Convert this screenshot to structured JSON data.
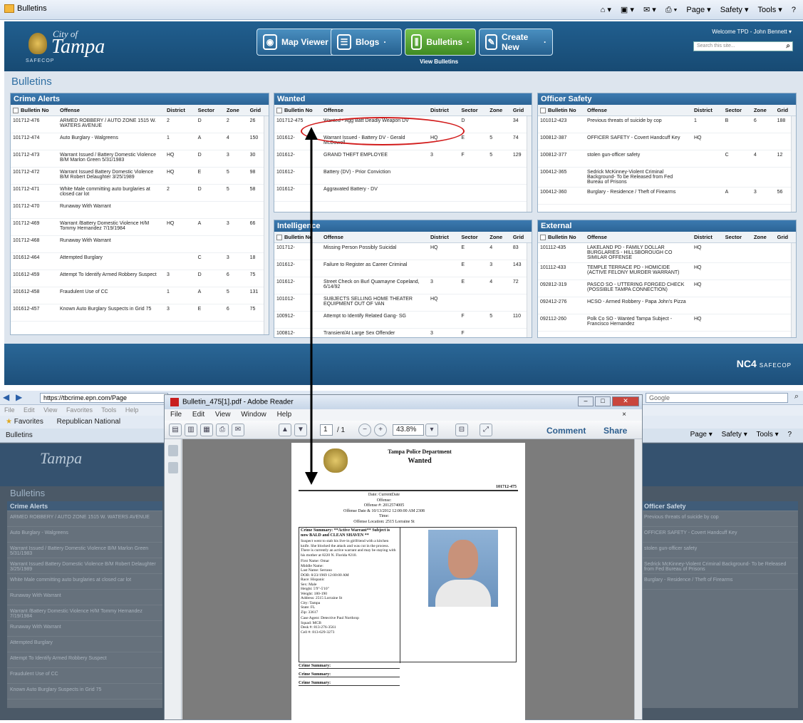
{
  "ie_top": {
    "tab": "Bulletins",
    "commands": [
      "Page ▾",
      "Safety ▾",
      "Tools ▾",
      "?"
    ]
  },
  "site": {
    "city": "City of",
    "name": "Tampa",
    "logo_sub": "SAFECOP",
    "nav": [
      {
        "label": "Map Viewer",
        "icon": "map-pin-icon",
        "active": false
      },
      {
        "label": "Blogs",
        "icon": "chat-icon",
        "active": false
      },
      {
        "label": "Bulletins",
        "icon": "bulletins-icon",
        "active": true
      },
      {
        "label": "Create New",
        "icon": "edit-icon",
        "active": false
      }
    ],
    "view_bulletins": "View Bulletins",
    "welcome": "Welcome TPD - John Bennett",
    "search_placeholder": "Search this site...",
    "page_title": "Bulletins",
    "footer_brand": "NC4",
    "footer_sub": "SAFECOP"
  },
  "columns": [
    "Bulletin No",
    "Offense",
    "District",
    "Sector",
    "Zone",
    "Grid"
  ],
  "crime_alerts": {
    "title": "Crime Alerts",
    "rows": [
      [
        "101712-476",
        "ARMED ROBBERY / AUTO ZONE 1515 W. WATERS AVENUE",
        "2",
        "D",
        "2",
        "26"
      ],
      [
        "101712-474",
        "Auto Burglary - Walgreens",
        "1",
        "A",
        "4",
        "150"
      ],
      [
        "101712-473",
        "Warrant Issued / Battery Domestic Violence B/M Marlon Green 5/31/1983",
        "HQ",
        "D",
        "3",
        "30"
      ],
      [
        "101712-472",
        "Warrant Issued Battery Domestic Violence B/M Robert Delaughter 3/25/1989",
        "HQ",
        "E",
        "5",
        "98"
      ],
      [
        "101712-471",
        "White Male committing auto burglaries at closed car lot",
        "2",
        "D",
        "5",
        "58"
      ],
      [
        "101712-470",
        "Runaway With Warrant",
        "",
        "",
        "",
        ""
      ],
      [
        "101712-469",
        "Warrant /Battery Domestic Violence H/M Tommy Hernandez 7/19/1984",
        "HQ",
        "A",
        "3",
        "66"
      ],
      [
        "101712-468",
        "Runaway With Warrant",
        "",
        "",
        "",
        ""
      ],
      [
        "101612-464",
        "Attempted Burglary",
        "",
        "C",
        "3",
        "18"
      ],
      [
        "101612-459",
        "Attempt To Identify Armed Robbery Suspect",
        "3",
        "D",
        "6",
        "75"
      ],
      [
        "101612-458",
        "Fraudulent Use of CC",
        "1",
        "A",
        "5",
        "131"
      ],
      [
        "101612-457",
        "Known Auto Burglary Suspects in Grid 75",
        "3",
        "E",
        "6",
        "75"
      ]
    ]
  },
  "wanted": {
    "title": "Wanted",
    "rows": [
      [
        "101712-475",
        "Wanted - Agg Batt Deadly Weapon DV",
        "",
        "D",
        "",
        "34"
      ],
      [
        "101612-",
        "Warrant Issued - Battery DV - Gerald McDowell",
        "HQ",
        "E",
        "5",
        "74"
      ],
      [
        "101612-",
        "GRAND THEFT EMPLOYEE",
        "3",
        "F",
        "5",
        "129"
      ],
      [
        "101612-",
        "Battery (DV) - Prior Conviction",
        "",
        "",
        "",
        ""
      ],
      [
        "101612-",
        "Aggravated Battery - DV",
        "",
        "",
        "",
        ""
      ]
    ]
  },
  "intelligence": {
    "title": "Intelligence",
    "rows": [
      [
        "101712-",
        "Missing Person Possibly Suicidal",
        "HQ",
        "E",
        "4",
        "83"
      ],
      [
        "101612-",
        "Failure to Register as Career Criminal",
        "",
        "E",
        "3",
        "143"
      ],
      [
        "101612-",
        "Street Check on Burl Quamayne Copeland, 6/14/92",
        "3",
        "E",
        "4",
        "72"
      ],
      [
        "101012-",
        "SUBJECTS SELLING HOME THEATER EQUIPMENT OUT OF VAN",
        "HQ",
        "",
        "",
        ""
      ],
      [
        "100912-",
        "Attempt to Identify Related Gang- SG",
        "",
        "F",
        "5",
        "110"
      ],
      [
        "100812-",
        "Transient/At Large Sex Offender",
        "3",
        "F",
        "",
        ""
      ]
    ]
  },
  "officer_safety": {
    "title": "Officer Safety",
    "rows": [
      [
        "101012-423",
        "Previous threats of suicide by cop",
        "1",
        "B",
        "6",
        "188"
      ],
      [
        "100812-387",
        "OFFICER SAFETY - Covert Handcuff Key",
        "HQ",
        "",
        "",
        ""
      ],
      [
        "100812-377",
        "stolen gun-officer safety",
        "",
        "C",
        "4",
        "12"
      ],
      [
        "100412-365",
        "Sedrick McKinney-Violent Criminal Background- To be Released from Fed Bureau of Prisons",
        "",
        "",
        "",
        ""
      ],
      [
        "100412-360",
        "Burglary - Residence / Theft of Firearms",
        "",
        "A",
        "3",
        "56"
      ]
    ]
  },
  "external": {
    "title": "External",
    "rows": [
      [
        "101112-435",
        "LAKELAND PD - FAMILY DOLLAR BURGLARIES - HILLSBOROUGH CO SIMILAR OFFENSE",
        "HQ",
        "",
        "",
        ""
      ],
      [
        "101112-433",
        "TEMPLE TERRACE PD - HOMICIDE (ACTIVE FELONY MURDER WARRANT)",
        "HQ",
        "",
        "",
        ""
      ],
      [
        "092812-319",
        "PASCO SO - UTTERING FORGED CHECK (POSSIBLE TAMPA CONNECTION)",
        "HQ",
        "",
        "",
        ""
      ],
      [
        "092412-276",
        "HCSO - Armed Robbery - Papa John's Pizza",
        "",
        "",
        "",
        ""
      ],
      [
        "092112-260",
        "Polk Co SO - Wanted Tampa Subject - Francisco Hernandez",
        "HQ",
        "",
        "",
        ""
      ]
    ]
  },
  "ie2": {
    "url": "https://tbcrime.epn.com/Page",
    "search": "Google",
    "menu": [
      "File",
      "Edit",
      "View",
      "Favorites",
      "Tools",
      "Help"
    ],
    "favorites": "Favorites",
    "fav_link": "Republican National",
    "tab": "Bulletins",
    "commands": [
      "Page ▾",
      "Safety ▾",
      "Tools ▾",
      "?"
    ]
  },
  "acrobat": {
    "title": "Bulletin_475[1].pdf - Adobe Reader",
    "menu": [
      "File",
      "Edit",
      "View",
      "Window",
      "Help"
    ],
    "page": "1",
    "page_total": "/ 1",
    "zoom": "43.8%",
    "comment": "Comment",
    "share": "Share"
  },
  "pdf": {
    "dept": "Tampa Police Department",
    "kind": "Wanted",
    "bulletin_no": "101712-475",
    "meta": [
      "Date: CurrentDate",
      "Offense:",
      "Offense #: 2012574005",
      "Offense Date & 10/13/2012 12:00:00 AM 2308",
      "Time:",
      "Offense Location: 2515 Lorraine St"
    ],
    "summary_head": "Crime Summary: **Active Warrant** Subject is now BALD and CLEAN SHAVEN **",
    "summary": "Suspect went to stab his live-in girlfriend with a kitchen knife. She blocked the attack and was cut in the process. There is currently an active warrant and may be staying with his mother at 8220 N. Florida #210.",
    "fields": [
      "First Name: Omar",
      "Middle Name:",
      "Last Name: Serrano",
      "DOB: 8/23/1969 12:00:00 AM",
      "Race: Hispanic",
      "Sex: Male",
      "Height: 5'9\"-5'10\"",
      "Weight: 180-190",
      "Address: 2515 Lorraine St",
      "City: Tampa",
      "State: FL",
      "Zip: 33617"
    ],
    "agent": [
      "Case Agent: Detective Paul Northrop",
      "Squad: MCB",
      "Desk #: 813-276-3561",
      "Cell #: 813-629-3273"
    ],
    "sections": [
      "Crime Summary:",
      "Crime Summary:",
      "Crime Summary:"
    ]
  }
}
